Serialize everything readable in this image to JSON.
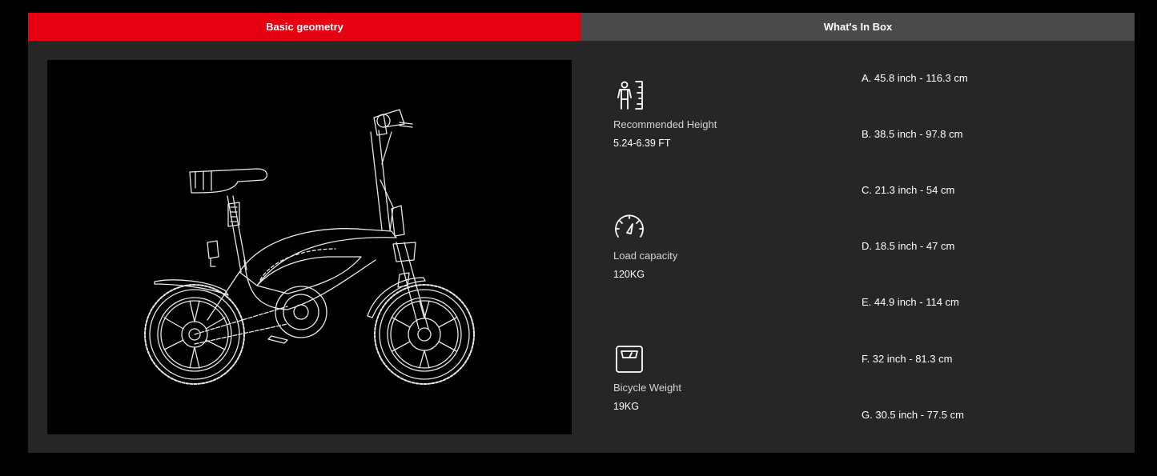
{
  "tabs": [
    {
      "label": "Basic geometry",
      "active": true
    },
    {
      "label": "What's In Box",
      "active": false
    }
  ],
  "colors": {
    "accent": "#e60012",
    "panel": "#262626",
    "inactive_tab": "#4a4a4a",
    "background": "#000000"
  },
  "image": {
    "alt_icon": "folding-ebike-wireframe-drawing"
  },
  "specs": [
    {
      "icon": "person-height-icon",
      "label": "Recommended Height",
      "value": "5.24-6.39 FT"
    },
    {
      "icon": "speedometer-icon",
      "label": "Load capacity",
      "value": "120KG"
    },
    {
      "icon": "scale-icon",
      "label": "Bicycle Weight",
      "value": "19KG"
    }
  ],
  "dimensions": [
    "A. 45.8 inch - 116.3 cm",
    "B. 38.5 inch - 97.8 cm",
    "C. 21.3 inch - 54 cm",
    "D. 18.5 inch - 47 cm",
    "E. 44.9 inch - 114 cm",
    "F. 32 inch - 81.3 cm",
    "G. 30.5 inch - 77.5 cm"
  ]
}
